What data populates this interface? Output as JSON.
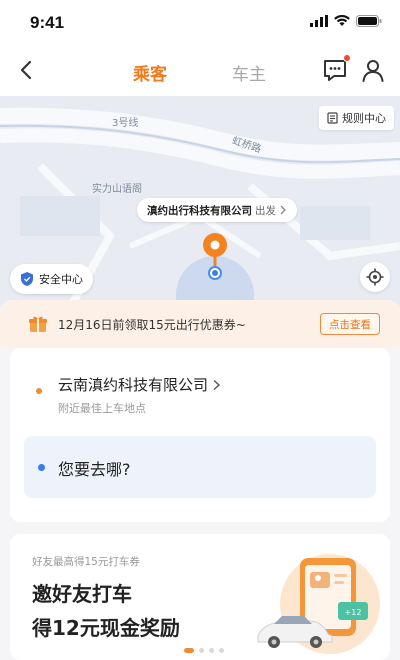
{
  "status_bar": {
    "time": "9:41"
  },
  "header": {
    "tab_passenger": "乘客",
    "tab_driver": "车主",
    "accent_color": "#f07a1a"
  },
  "map": {
    "rule_center_label": "规则中心",
    "road_label_1": "3号线",
    "road_label_2": "虹桥路",
    "place_label": "实力山语阁",
    "depart_company": "滇约出行科技有限公司",
    "depart_suffix": "出发",
    "safety_center_label": "安全中心"
  },
  "promo": {
    "text": "12月16日前领取15元出行优惠券~",
    "button_label": "点击查看"
  },
  "route_card": {
    "from_name": "云南滇约科技有限公司",
    "from_sub": "附近最佳上车地点",
    "destination_placeholder": "您要去哪?"
  },
  "banner": {
    "subtitle": "好友最高得15元打车券",
    "title_line1": "邀好友打车",
    "title_line2": "得12元现金奖励",
    "active_page": 1,
    "page_count": 4
  }
}
